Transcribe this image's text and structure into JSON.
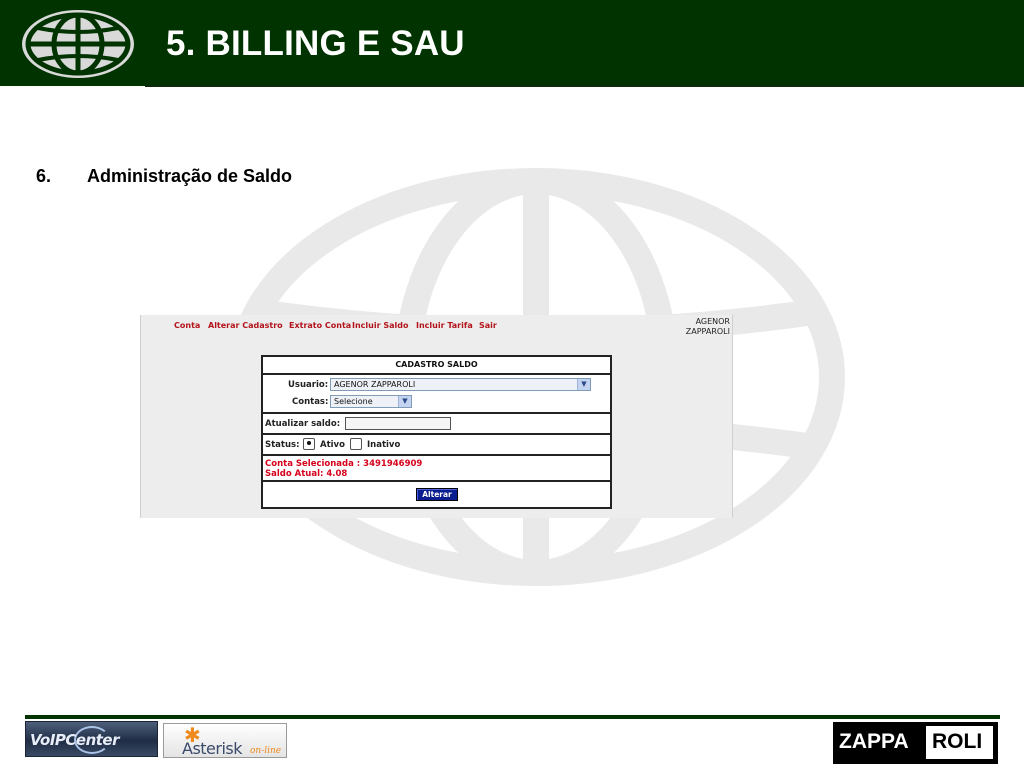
{
  "slide": {
    "title": "5. BILLING E SAU"
  },
  "section": {
    "number": "6.",
    "title": "Administração de Saldo"
  },
  "app": {
    "nav": [
      "Conta",
      "Alterar Cadastro",
      "Extrato Conta",
      "Incluir Saldo",
      "Incluir Tarifa",
      "Sair"
    ],
    "user_line1": "AGENOR",
    "user_line2": "ZAPPAROLI",
    "form": {
      "title": "CADASTRO SALDO",
      "usuario_label": "Usuario:",
      "usuario_value": "AGENOR ZAPPAROLI",
      "contas_label": "Contas:",
      "contas_value": "Selecione",
      "atualizar_label": "Atualizar saldo:",
      "atualizar_value": "",
      "status_label": "Status:",
      "ativo_label": "Ativo",
      "inativo_label": "Inativo",
      "selected_status": "Ativo",
      "conta_selecionada": "Conta Selecionada : 3491946909",
      "saldo_atual": "Saldo Atual: 4.08",
      "submit_label": "Alterar"
    }
  },
  "footer": {
    "voip_logo": "VoIPCenter",
    "asterisk_logo": "Asterisk",
    "asterisk_tag": "on-line",
    "zappa_part1": "ZAPPA",
    "zappa_part2": "ROLI"
  },
  "colors": {
    "header_green": "#003300",
    "nav_red": "#b3141b",
    "info_red": "#d6001c",
    "button_blue": "#0b1e8f"
  }
}
